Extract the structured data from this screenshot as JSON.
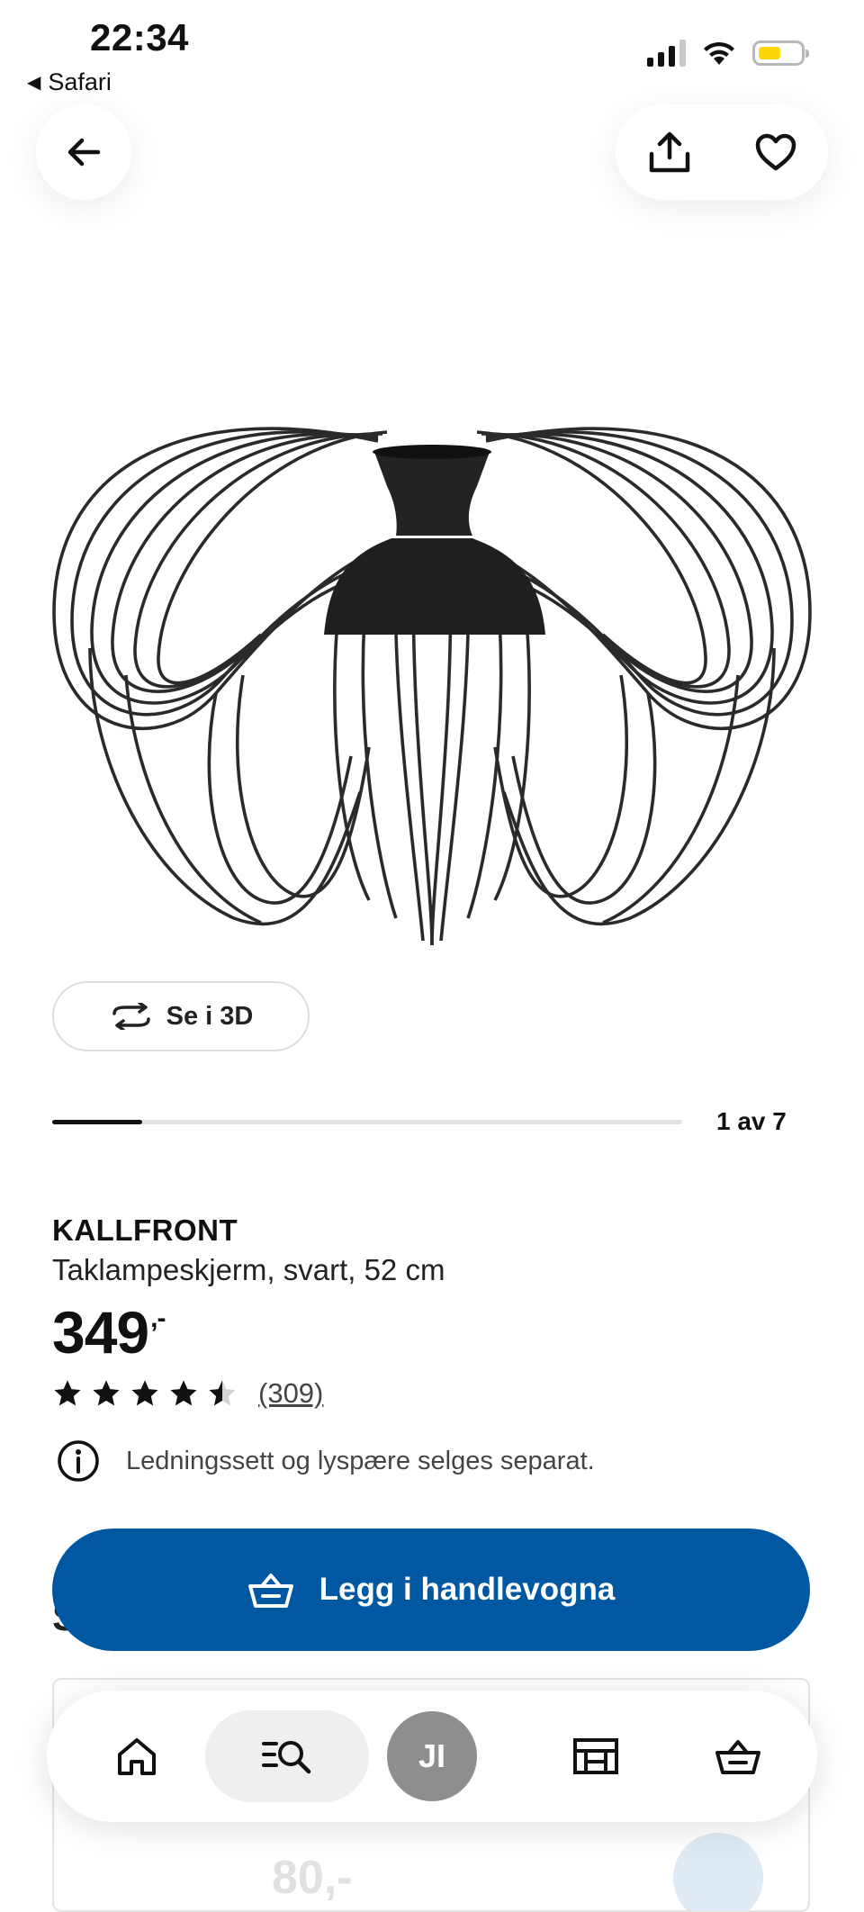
{
  "status_bar": {
    "time": "22:34",
    "back_app": "Safari"
  },
  "icons": {
    "back": "arrow-left-icon",
    "share": "share-icon",
    "favorite": "heart-icon",
    "rotate": "rotate-3d-icon",
    "info": "info-icon",
    "basket": "basket-icon",
    "home": "home-icon",
    "search": "search-list-icon",
    "store": "store-icon",
    "cart": "cart-icon"
  },
  "viewer": {
    "view_3d_label": "Se i 3D",
    "page_indicator": "1 av 7",
    "progress": 0.143
  },
  "product": {
    "name": "KALLFRONT",
    "description": "Taklampeskjerm, svart, 52 cm",
    "price": "349",
    "price_suffix": ",-",
    "rating": 4.5,
    "rating_count": "(309)",
    "info_note": "Ledningssett og lyspære selges separat."
  },
  "cart_button": {
    "label": "Legg i handlevogna",
    "color": "#0058a3"
  },
  "partial_section_letter": "S",
  "related": {
    "price_fragment": "80,-"
  },
  "bottom_nav": {
    "avatar_initials": "JI"
  }
}
